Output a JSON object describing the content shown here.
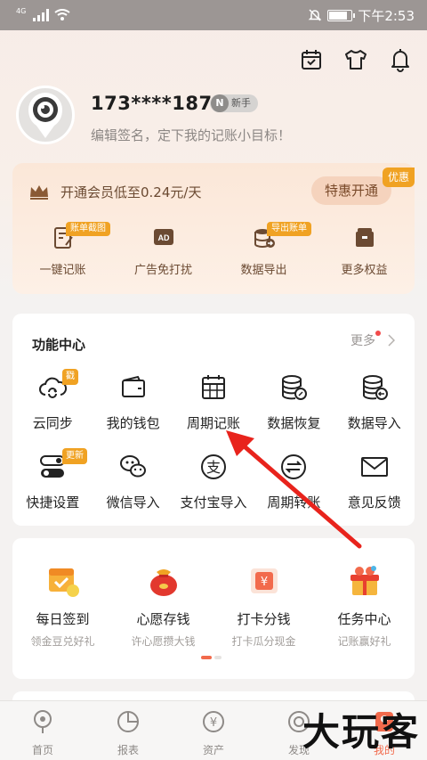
{
  "status_bar": {
    "network": "4G",
    "time": "下午2:53"
  },
  "header": {
    "icons": [
      "calendar-icon",
      "tshirt-icon",
      "bell-icon"
    ]
  },
  "profile": {
    "username": "173****1871",
    "badge_letter": "N",
    "badge": "新手",
    "signature": "编辑签名，定下我的记账小目标！"
  },
  "vip": {
    "text": "开通会员低至0.24元/天",
    "button": "特惠开通",
    "tag": "优惠",
    "perks": [
      {
        "label": "一键记账",
        "badge": "账单截图",
        "icon": "quick-note-icon"
      },
      {
        "label": "广告免打扰",
        "badge": "",
        "icon": "ad-free-icon",
        "icon_text": "AD"
      },
      {
        "label": "数据导出",
        "badge": "导出账单",
        "icon": "data-export-icon"
      },
      {
        "label": "更多权益",
        "badge": "",
        "icon": "more-benefits-icon"
      }
    ]
  },
  "functions": {
    "title": "功能中心",
    "more": "更多",
    "items": [
      {
        "label": "云同步",
        "badge": "戳",
        "icon": "cloud-sync-icon"
      },
      {
        "label": "我的钱包",
        "badge": "",
        "icon": "wallet-icon"
      },
      {
        "label": "周期记账",
        "badge": "",
        "icon": "calendar-grid-icon"
      },
      {
        "label": "数据恢复",
        "badge": "",
        "icon": "data-restore-icon"
      },
      {
        "label": "数据导入",
        "badge": "",
        "icon": "data-import-icon"
      },
      {
        "label": "快捷设置",
        "badge": "更新",
        "icon": "toggle-settings-icon"
      },
      {
        "label": "微信导入",
        "badge": "",
        "icon": "wechat-icon"
      },
      {
        "label": "支付宝导入",
        "badge": "",
        "icon": "alipay-icon",
        "icon_text": "支"
      },
      {
        "label": "周期转账",
        "badge": "",
        "icon": "transfer-icon"
      },
      {
        "label": "意见反馈",
        "badge": "",
        "icon": "mail-icon"
      }
    ]
  },
  "tasks": {
    "items": [
      {
        "label": "每日签到",
        "sub": "领金豆兑好礼",
        "icon": "checkin-calendar-icon"
      },
      {
        "label": "心愿存钱",
        "sub": "许心愿攒大钱",
        "icon": "money-bag-icon"
      },
      {
        "label": "打卡分钱",
        "sub": "打卡瓜分现金",
        "icon": "red-envelope-icon",
        "icon_text": "¥"
      },
      {
        "label": "任务中心",
        "sub": "记账赢好礼",
        "icon": "gift-box-icon"
      }
    ],
    "page_count": 2,
    "active_page": 1
  },
  "bottom_nav": [
    {
      "label": "首页",
      "icon": "home-pin-icon"
    },
    {
      "label": "报表",
      "icon": "pie-chart-icon"
    },
    {
      "label": "资产",
      "icon": "yen-coin-icon",
      "icon_text": "¥"
    },
    {
      "label": "发现",
      "icon": "discover-icon"
    },
    {
      "label": "我的",
      "icon": "profile-icon"
    }
  ],
  "watermark": "大玩客",
  "colors": {
    "accent": "#f0a223",
    "vip_text": "#6b4a32",
    "annotation_arrow": "#e8231c",
    "status_bar": "#9c9694"
  }
}
